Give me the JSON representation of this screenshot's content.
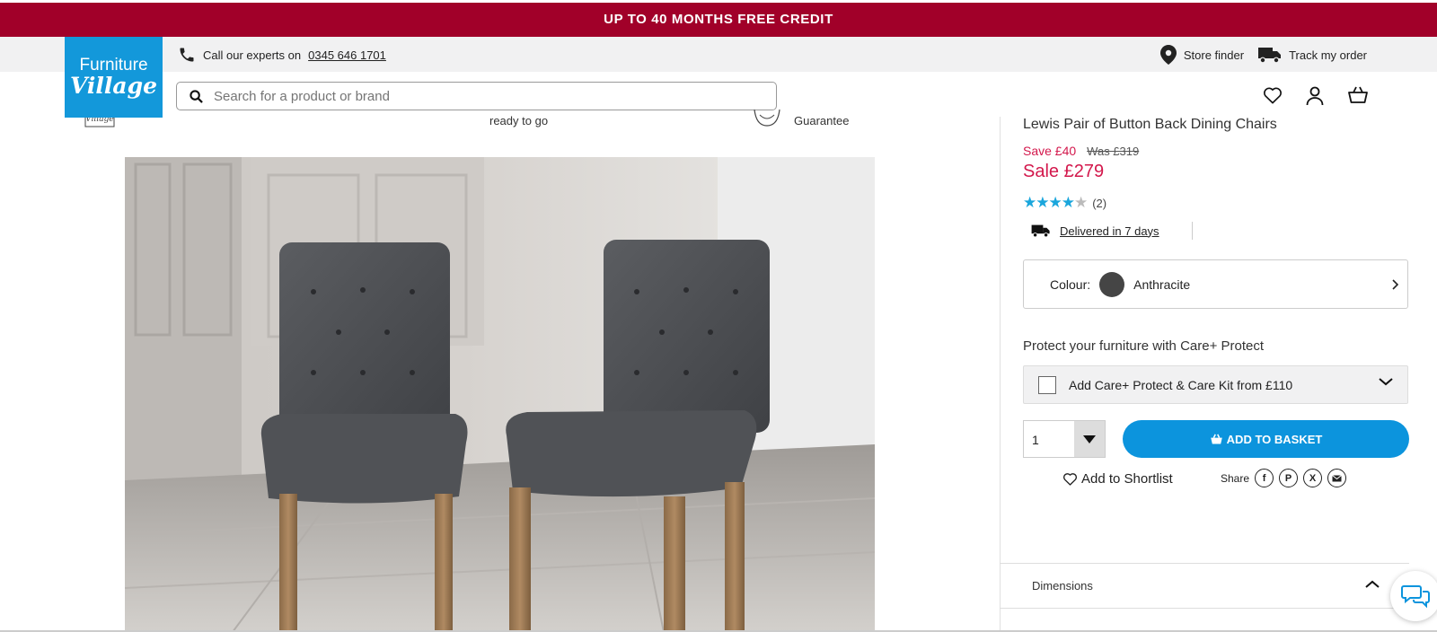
{
  "promo": {
    "text": "UP TO 40 MONTHS FREE CREDIT"
  },
  "logo": {
    "line1": "Furniture",
    "line2": "Village"
  },
  "utility": {
    "call_prefix": "Call our experts on",
    "phone": "0345 646 1701",
    "store_finder": "Store finder",
    "track_order": "Track my order"
  },
  "search": {
    "placeholder": "Search for a product or brand"
  },
  "usp": {
    "ready": "ready to go",
    "guarantee": "Guarantee"
  },
  "product": {
    "title": "Lewis Pair of Button Back Dining Chairs",
    "save": "Save £40",
    "was": "Was £319",
    "sale": "Sale £279",
    "rating_value": 4,
    "rating_max": 5,
    "review_count": "(2)",
    "delivery": "Delivered in 7 days",
    "colour_label": "Colour:",
    "colour_value": "Anthracite",
    "colour_hex": "#454545"
  },
  "protect": {
    "heading": "Protect your furniture with Care+ Protect",
    "option": "Add Care+ Protect & Care Kit from £110"
  },
  "purchase": {
    "quantity": "1",
    "add_to_basket": "ADD TO BASKET",
    "shortlist": "Add to Shortlist",
    "share": "Share"
  },
  "dimensions": {
    "label": "Dimensions"
  },
  "colors": {
    "promo": "#a10029",
    "brand": "#1398da",
    "cta": "#0c94dd",
    "sale": "#d3184c",
    "stars": "#1aa6dc"
  }
}
